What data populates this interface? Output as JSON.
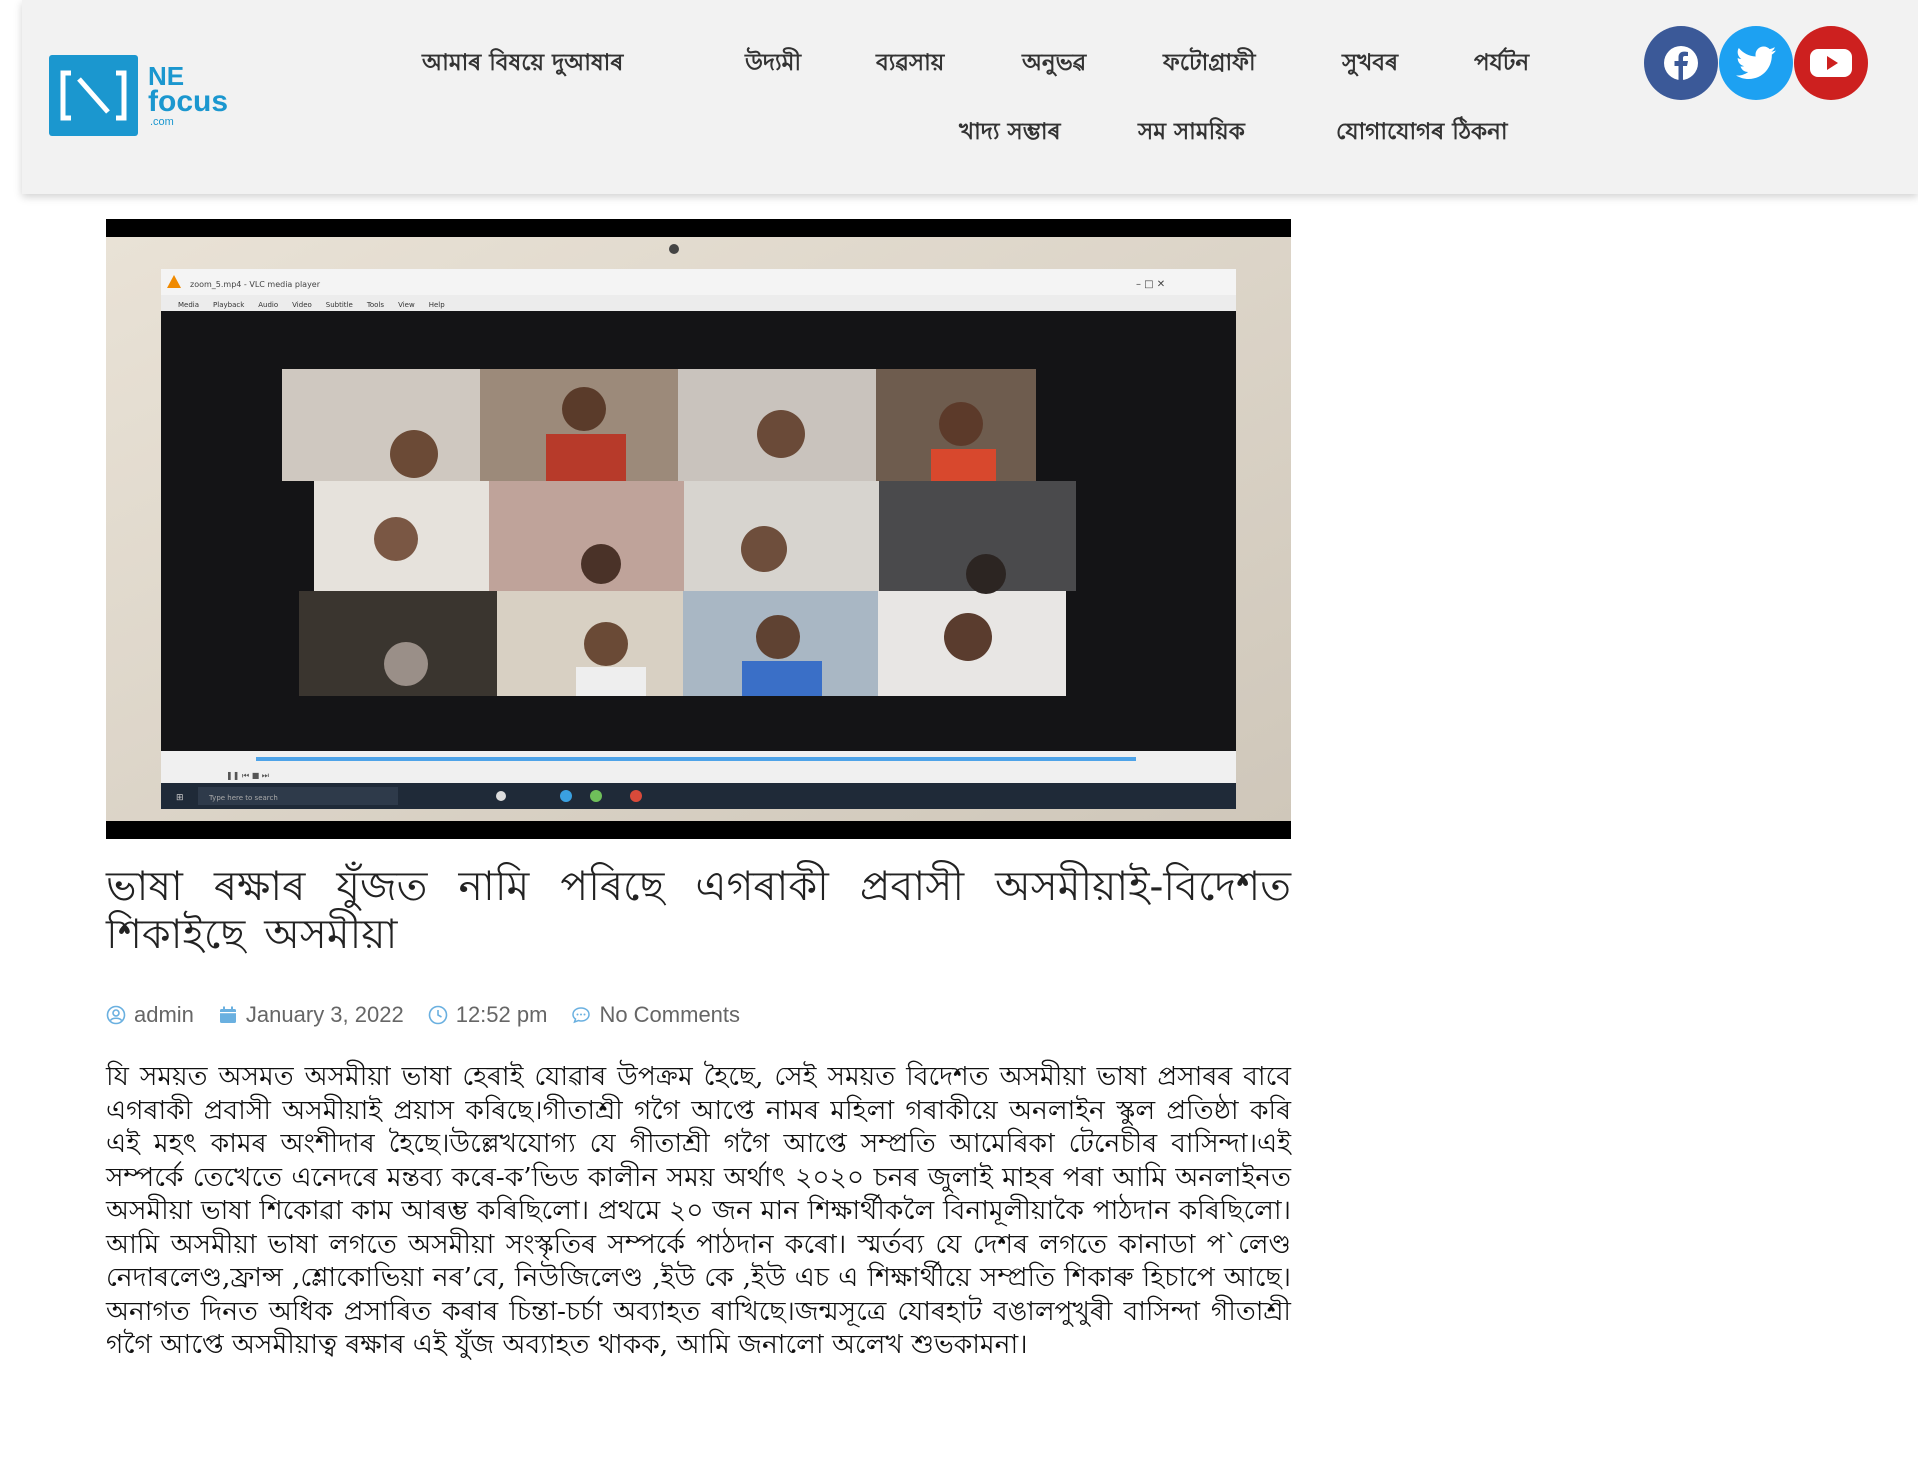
{
  "logo": {
    "line1": "NE",
    "line2": "focus",
    "line3": ".com"
  },
  "nav": {
    "row1": [
      "আমাৰ বিষয়ে দুআষাৰ",
      "উদ্যমী",
      "ব্যৱসায়",
      "অনুভৱ",
      "ফটোগ্ৰাফী",
      "সুখবৰ",
      "পৰ্যটন"
    ],
    "row2": [
      "খাদ্য সম্ভাৰ",
      "সম সাময়িক",
      "যোগাযোগৰ ঠিকনা"
    ]
  },
  "social": [
    {
      "icon": "facebook-icon",
      "color": "#3b5998"
    },
    {
      "icon": "twitter-icon",
      "color": "#1da1f2"
    },
    {
      "icon": "youtube-icon",
      "color": "#cd201f"
    }
  ],
  "article": {
    "title": "ভাষা ৰক্ষাৰ যুঁজত নামি পৰিছে এগৰাকী প্ৰবাসী অসমীয়াই-বিদেশত শিকাইছে অসমীয়া",
    "meta": {
      "author": "admin",
      "date": "January 3, 2022",
      "time": "12:52 pm",
      "comments": "No Comments"
    },
    "body": "যি সময়ত অসমত অসমীয়া ভাষা হেৰাই যোৱাৰ উপক্ৰম হৈছে, সেই সময়ত বিদেশত অসমীয়া ভাষা প্ৰসাৰৰ বাবে এগৰাকী প্ৰবাসী অসমীয়াই প্ৰয়াস কৰিছে।গীতাশ্ৰী গগৈ আপ্তে নামৰ মহিলা গৰাকীয়ে অনলাইন স্কুল প্ৰতিষ্ঠা কৰি এই মহৎ কামৰ অংশীদাৰ হৈছে।উল্লেখযোগ্য যে গীতাশ্ৰী গগৈ আপ্তে সম্প্ৰতি আমেৰিকা টেনেচীৰ বাসিন্দা।এই সম্পৰ্কে তেখেতে এনেদৰে মন্তব্য কৰে-ক’ভিড কালীন সময় অৰ্থাৎ ২০২০ চনৰ জুলাই মাহৰ পৰা আমি অনলাইনত অসমীয়া ভাষা শিকোৱা কাম আৰম্ভ কৰিছিলো। প্ৰথমে ২০ জন মান শিক্ষাৰ্থীকলৈ বিনামূলীয়াকৈ পাঠদান কৰিছিলো।আমি অসমীয়া ভাষা লগতে অসমীয়া সংস্কৃতিৰ সম্পৰ্কে পাঠদান কৰো। স্মৰ্তব্য যে দেশৰ লগতে কানাডা প`লেণ্ড নেদাৰলেণ্ড,ফ্ৰান্স ,শ্লোকোভিয়া নৰ’বে, নিউজিলেণ্ড ,ইউ কে ,ইউ এচ এ শিক্ষাৰ্থীয়ে সম্প্ৰতি শিকাৰু হিচাপে আছে। অনাগত দিনত অধিক প্ৰসাৰিত কৰাৰ চিন্তা-চৰ্চা অব্যাহত ৰাখিছে।জন্মসূত্ৰে যোৰহাট বঙালপুখুৰী বাসিন্দা গীতাশ্ৰী গগৈ আপ্তে অসমীয়াত্ব ৰক্ষাৰ এই যুঁজ অব্যাহত থাকক, আমি জনালো অলেখ শুভকামনা।",
    "image": {
      "window_title": "zoom_5.mp4 - VLC media player",
      "menu": [
        "Media",
        "Playback",
        "Audio",
        "Video",
        "Subtitle",
        "Tools",
        "View",
        "Help"
      ],
      "search_placeholder": "Type here to search"
    }
  }
}
